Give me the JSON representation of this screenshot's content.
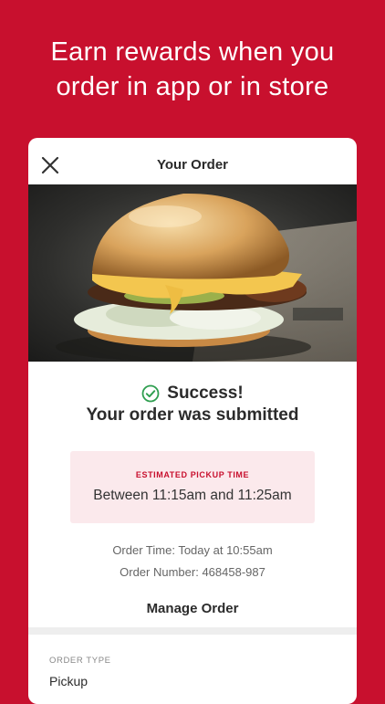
{
  "promo": {
    "line1": "Earn rewards when you",
    "line2": "order in app or in store"
  },
  "card": {
    "title": "Your Order",
    "close_icon": "close-icon",
    "hero_image": "burger-photo"
  },
  "status": {
    "icon": "check-circle-icon",
    "headline": "Success!",
    "message": "Your order was submitted"
  },
  "pickup": {
    "label": "ESTIMATED PICKUP TIME",
    "time": "Between 11:15am and 11:25am"
  },
  "details": {
    "order_time": "Order Time: Today at 10:55am",
    "order_number": "Order Number: 468458-987"
  },
  "actions": {
    "manage_label": "Manage Order"
  },
  "order_type": {
    "label": "ORDER TYPE",
    "value": "Pickup"
  },
  "colors": {
    "brand_red": "#c8102e",
    "success_green": "#2e9e4f",
    "pickup_bg": "#fbe9ec"
  }
}
